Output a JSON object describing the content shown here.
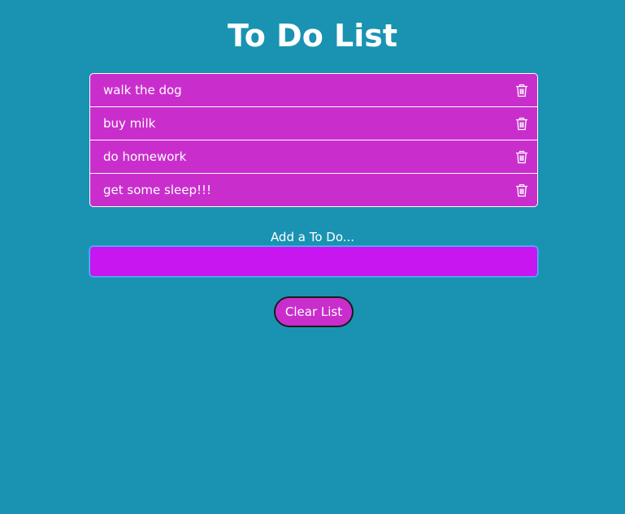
{
  "title": "To Do List",
  "todos": [
    {
      "text": "walk the dog"
    },
    {
      "text": "buy milk"
    },
    {
      "text": "do homework"
    },
    {
      "text": "get some sleep!!!"
    }
  ],
  "add_section": {
    "label": "Add a To Do...",
    "input_value": ""
  },
  "clear_button": {
    "label": "Clear List"
  },
  "colors": {
    "background": "#1a93b2",
    "list_item": "#c92ecd",
    "input_background": "#c816f0",
    "input_focus_border": "#4fb0ff",
    "text": "#ffffff"
  },
  "icons": {
    "delete": "trash-icon"
  }
}
